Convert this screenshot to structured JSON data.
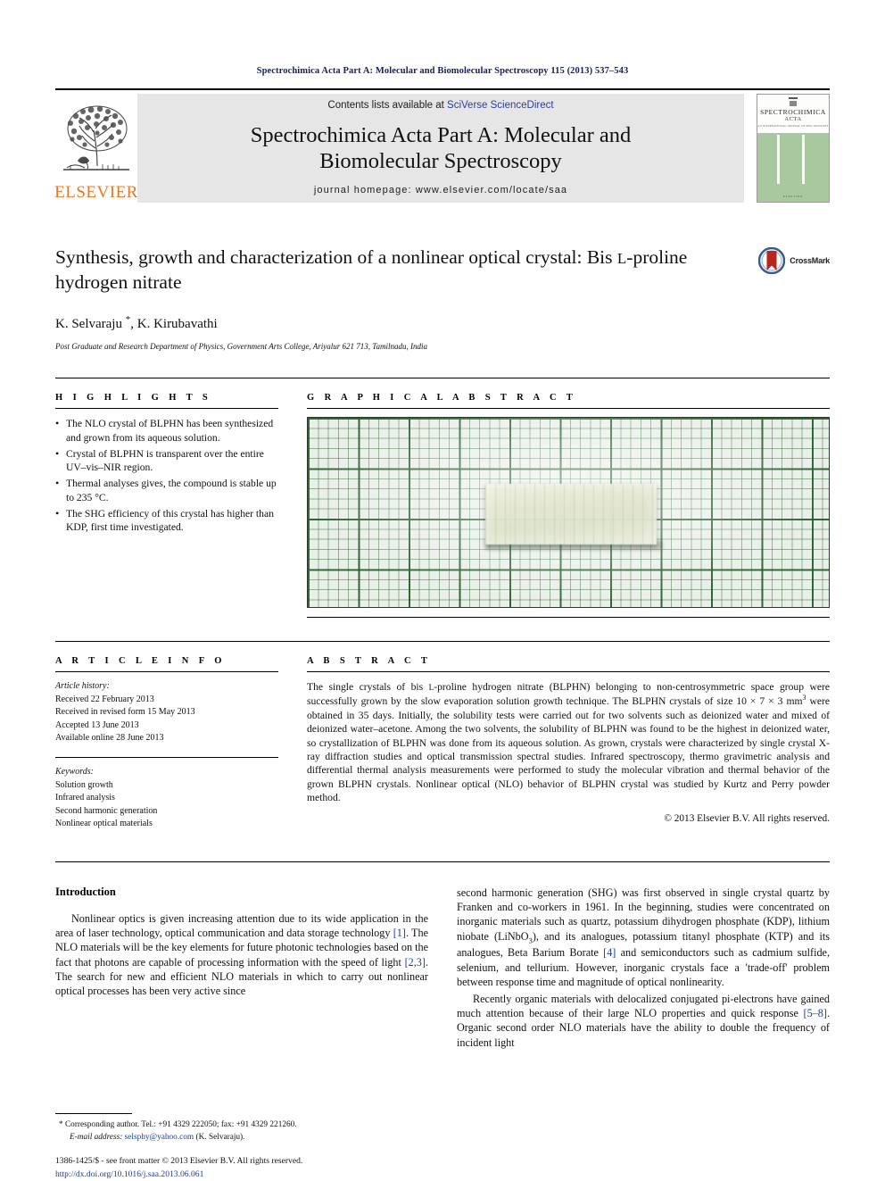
{
  "running_head": "Spectrochimica Acta Part A: Molecular and Biomolecular Spectroscopy 115 (2013) 537–543",
  "masthead": {
    "publisher_name": "ELSEVIER",
    "contents_prefix": "Contents lists available at ",
    "contents_link": "SciVerse ScienceDirect",
    "journal_title_line1": "Spectrochimica Acta Part A: Molecular and",
    "journal_title_line2": "Biomolecular Spectroscopy",
    "homepage": "journal homepage: www.elsevier.com/locate/saa",
    "cover": {
      "line1": "SPECTROCHIMICA",
      "line2": "ACTA",
      "line3": "AN INTERNATIONAL JOURNAL OF SPECTROSCOPY",
      "footer": "ELSEVIER"
    }
  },
  "article": {
    "title_line1": "Synthesis, growth and characterization of a nonlinear optical crystal: Bis",
    "title_smallcaps": "L",
    "title_line2_rest": "-proline hydrogen nitrate",
    "authors": "K. Selvaraju ",
    "authors_star": "*",
    "authors_rest": ", K. Kirubavathi",
    "affiliation": "Post Graduate and Research Department of Physics, Government Arts College, Ariyalur 621 713, Tamilnadu, India",
    "crossmark_label": "CrossMark"
  },
  "highlights": {
    "heading": "H I G H L I G H T S",
    "items": [
      "The NLO crystal of BLPHN has been synthesized and grown from its aqueous solution.",
      "Crystal of BLPHN is transparent over the entire UV–vis–NIR region.",
      "Thermal analyses gives, the compound is stable up to 235 °C.",
      "The SHG efficiency of this crystal has higher than KDP, first time investigated."
    ]
  },
  "graphical_abstract": {
    "heading": "G R A P H I C A L   A B S T R A C T",
    "image_alt": "Photograph of a transparent BLPHN single crystal resting on green millimetre graph paper"
  },
  "article_info": {
    "heading": "A R T I C L E   I N F O",
    "history_label": "Article history:",
    "history": [
      "Received 22 February 2013",
      "Received in revised form 15 May 2013",
      "Accepted 13 June 2013",
      "Available online 28 June 2013"
    ],
    "keywords_label": "Keywords:",
    "keywords": [
      "Solution growth",
      "Infrared analysis",
      "Second harmonic generation",
      "Nonlinear optical materials"
    ]
  },
  "abstract": {
    "heading": "A B S T R A C T",
    "part1": "The single crystals of bis ",
    "smallcaps": "L",
    "part2": "-proline hydrogen nitrate (BLPHN) belonging to non-centrosymmetric space group were successfully grown by the slow evaporation solution growth technique. The BLPHN crystals of size 10 × 7 × 3 mm",
    "superscript": "3",
    "part3": " were obtained in 35 days. Initially, the solubility tests were carried out for two solvents such as deionized water and mixed of deionized water–acetone. Among the two solvents, the solubility of BLPHN was found to be the highest in deionized water, so crystallization of BLPHN was done from its aqueous solution. As grown, crystals were characterized by single crystal X-ray diffraction studies and optical transmission spectral studies. Infrared spectroscopy, thermo gravimetric analysis and differential thermal analysis measurements were performed to study the molecular vibration and thermal behavior of the grown BLPHN crystals. Nonlinear optical (NLO) behavior of BLPHN crystal was studied by Kurtz and Perry powder method.",
    "copyright": "© 2013 Elsevier B.V. All rights reserved."
  },
  "introduction": {
    "heading": "Introduction",
    "left_p1_a": "Nonlinear optics is given increasing attention due to its wide application in the area of laser technology, optical communication and data storage technology ",
    "left_ref1": "[1]",
    "left_p1_b": ". The NLO materials will be the key elements for future photonic technologies based on the fact that photons are capable of processing information with the speed of light ",
    "left_ref2": "[2,3]",
    "left_p1_c": ". The search for new and efficient NLO materials in which to carry out nonlinear optical processes has been very active since",
    "right_p1_a": "second harmonic generation (SHG) was first observed in single crystal quartz by Franken and co-workers in 1961. In the beginning, studies were concentrated on inorganic materials such as quartz, potassium dihydrogen phosphate (KDP), lithium niobate (LiNbO",
    "right_sub": "3",
    "right_p1_b": "), and its analogues, potassium titanyl phosphate (KTP) and its analogues, Beta Barium Borate ",
    "right_ref1": "[4]",
    "right_p1_c": " and semiconductors such as cadmium sulfide, selenium, and tellurium. However, inorganic crystals face a 'trade-off' problem between response time and magnitude of optical nonlinearity.",
    "right_p2_a": "Recently organic materials with delocalized conjugated pi-electrons have gained much attention because of their large NLO properties and quick response ",
    "right_ref2": "[5–8]",
    "right_p2_b": ". Organic second order NLO materials have the ability to double the frequency of incident light"
  },
  "footnotes": {
    "corresponding": "Corresponding author. Tel.: +91 4329 222050; fax: +91 4329 221260.",
    "email_label": "E-mail address:",
    "email": "selsphy@yahoo.com",
    "email_suffix": " (K. Selvaraju).",
    "issn_line": "1386-1425/$ - see front matter © 2013 Elsevier B.V. All rights reserved.",
    "doi": "http://dx.doi.org/10.1016/j.saa.2013.06.061"
  },
  "colors": {
    "link_blue": "#1b3fa0",
    "elsevier_orange": "#E87722",
    "running_head_navy": "#1a2060",
    "masthead_grey": "#e6e6e6",
    "cover_green": "#a8c9a0"
  }
}
